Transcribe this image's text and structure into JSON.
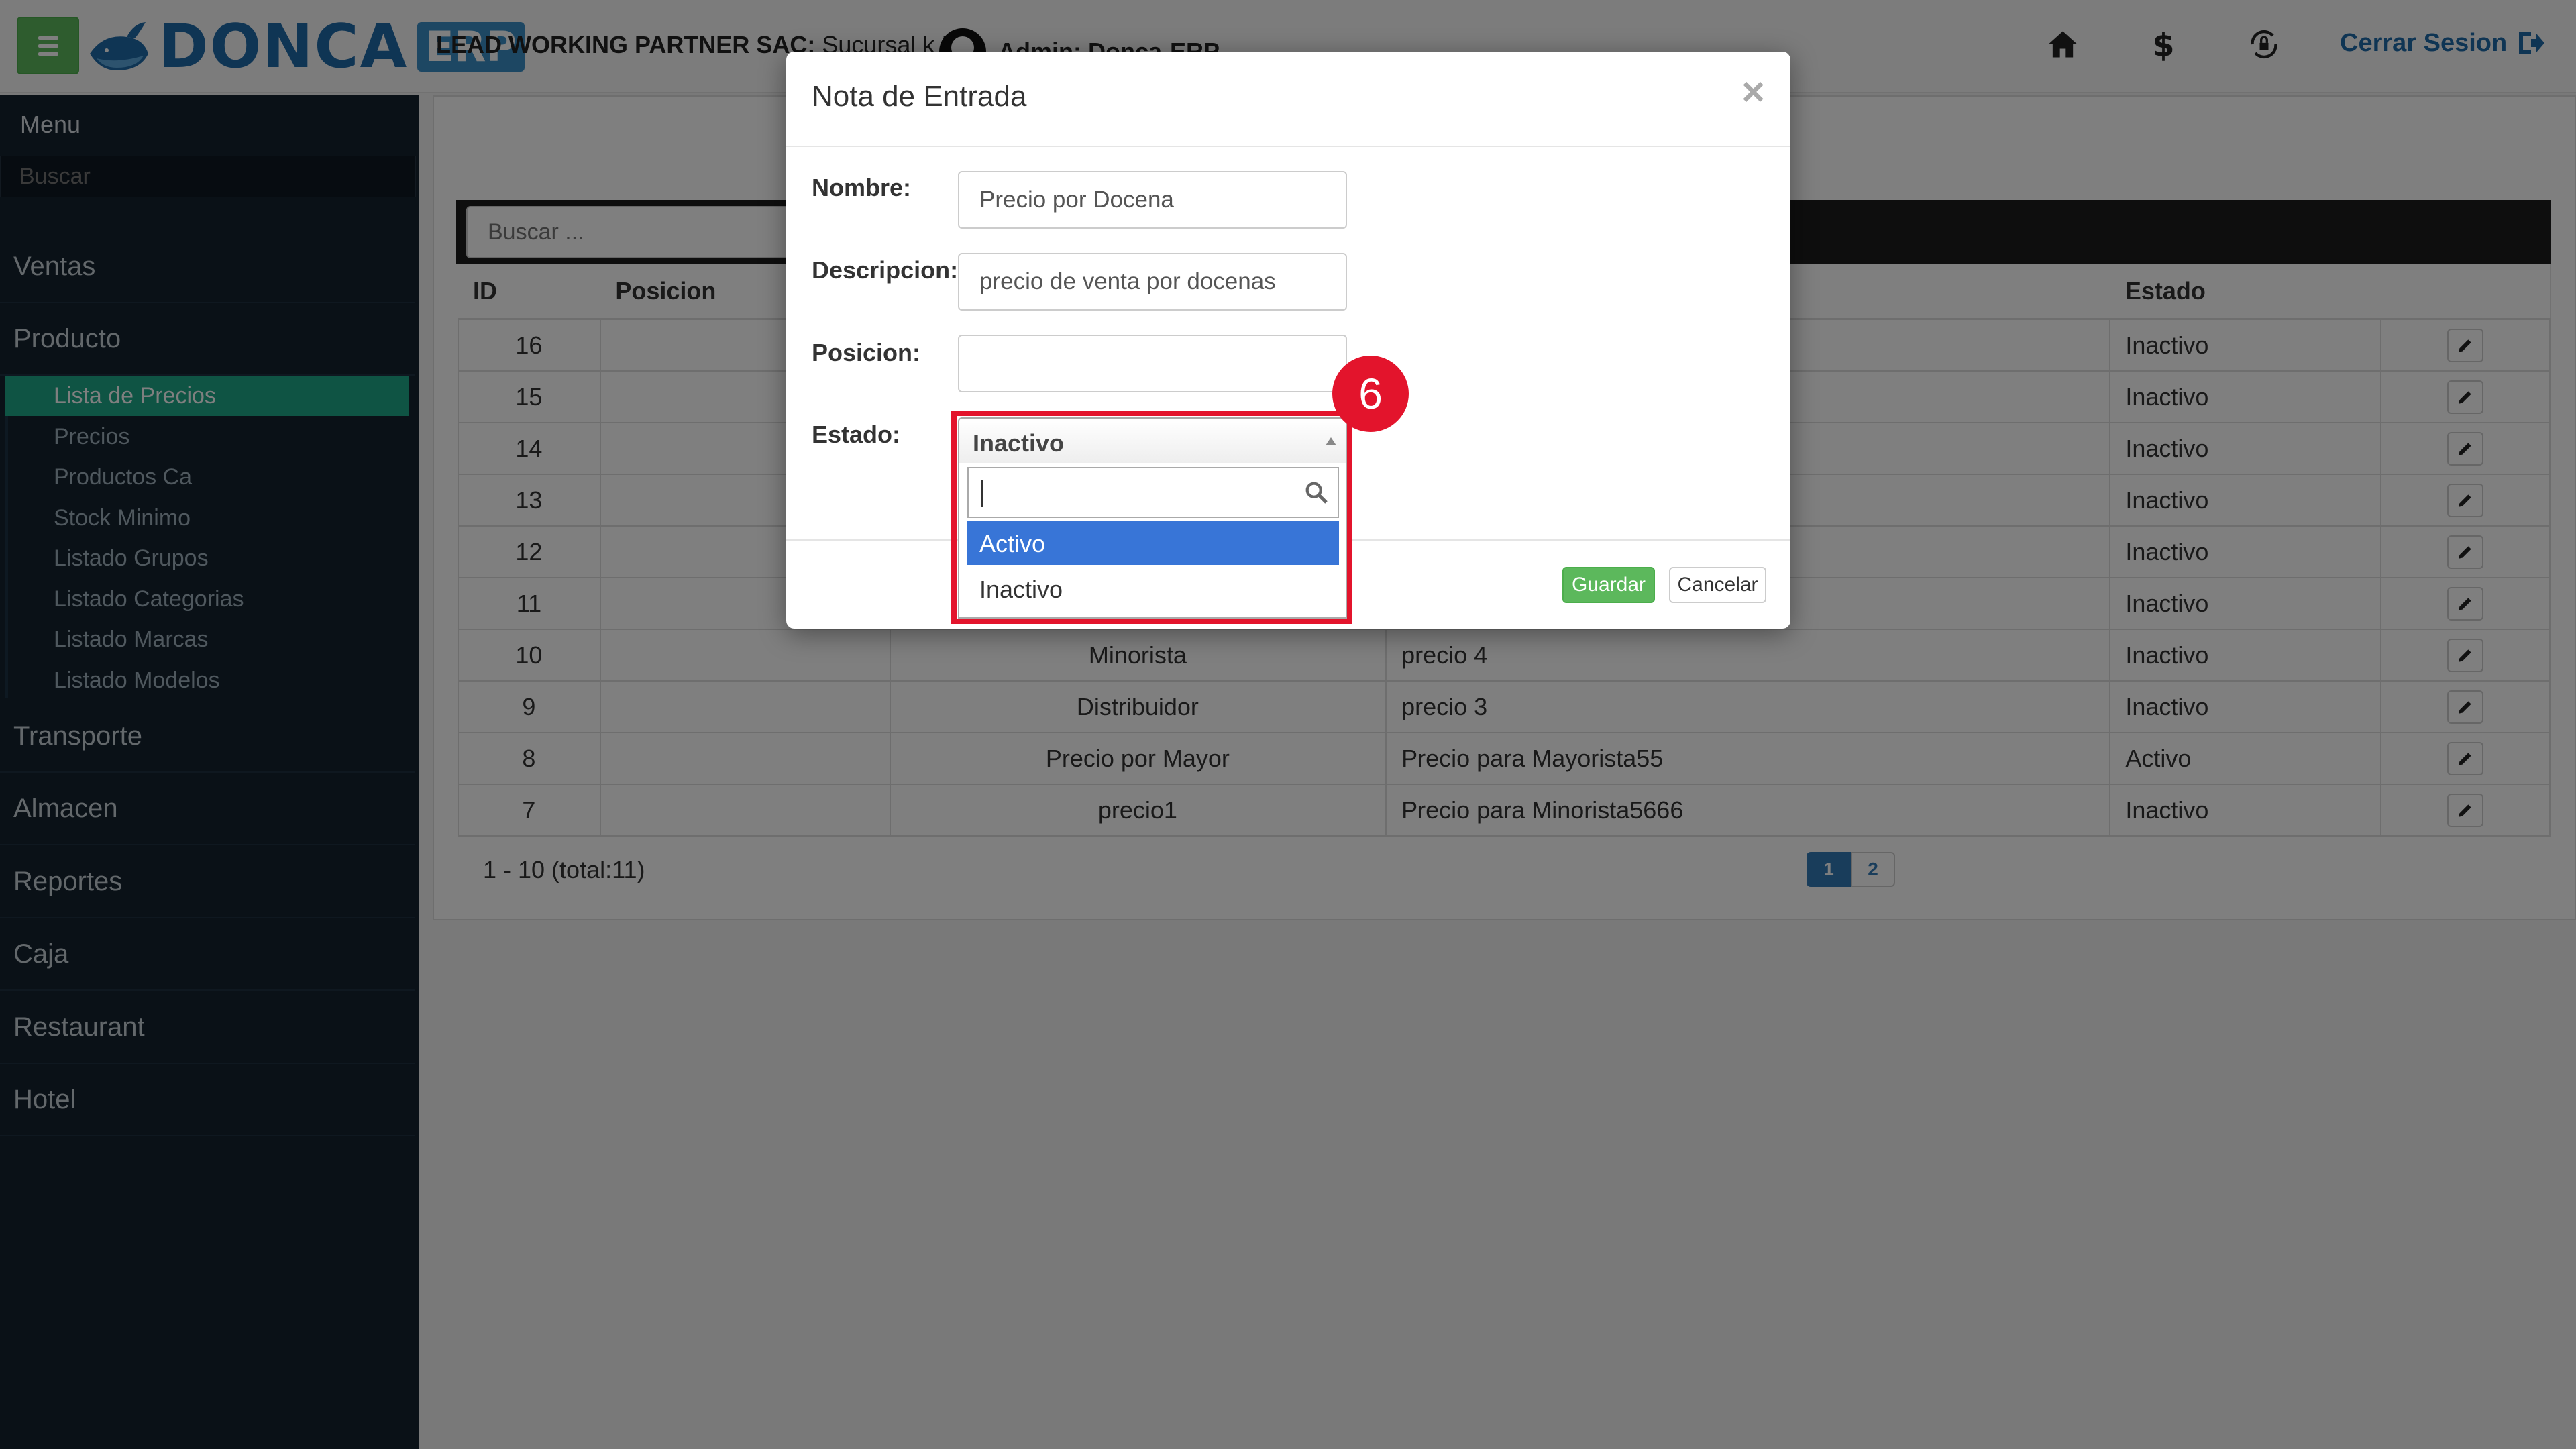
{
  "header": {
    "brand_name": "DONCA",
    "brand_suffix": "ERP",
    "company_prefix": "LEAD WORKING PARTNER SAC:",
    "company_branch": " Sucursal k |",
    "user_label": "Admin: Donca-ERP",
    "logout_label": "Cerrar Sesion",
    "icons": [
      "menu-icon",
      "home-icon",
      "dollar-icon",
      "lock-refresh-icon",
      "sign-out-icon"
    ]
  },
  "sidebar": {
    "menu_title": "Menu",
    "search_placeholder": "Buscar",
    "items": [
      "Ventas",
      "Producto",
      "Transporte",
      "Almacen",
      "Reportes",
      "Caja",
      "Restaurant",
      "Hotel"
    ],
    "sub_items": [
      "Lista de Precios",
      "Precios",
      "Productos Ca",
      "Stock Minimo",
      "Listado Grupos",
      "Listado Categorias",
      "Listado Marcas",
      "Listado Modelos"
    ],
    "active_sub": "Lista de Precios"
  },
  "table": {
    "search_placeholder": "Buscar ...",
    "columns": [
      "ID",
      "Posicion",
      "",
      "",
      "Estado",
      ""
    ],
    "rows": [
      {
        "id": "16",
        "posicion": "",
        "nombre": "",
        "descripcion": "",
        "estado": "Inactivo"
      },
      {
        "id": "15",
        "posicion": "",
        "nombre": "",
        "descripcion": "",
        "estado": "Inactivo"
      },
      {
        "id": "14",
        "posicion": "",
        "nombre": "",
        "descripcion": "",
        "estado": "Inactivo"
      },
      {
        "id": "13",
        "posicion": "",
        "nombre": "",
        "descripcion": "",
        "estado": "Inactivo"
      },
      {
        "id": "12",
        "posicion": "",
        "nombre": "",
        "descripcion": "",
        "estado": "Inactivo"
      },
      {
        "id": "11",
        "posicion": "",
        "nombre": "",
        "descripcion": "",
        "estado": "Inactivo"
      },
      {
        "id": "10",
        "posicion": "",
        "nombre": "Minorista",
        "descripcion": "precio 4",
        "estado": "Inactivo"
      },
      {
        "id": "9",
        "posicion": "",
        "nombre": "Distribuidor",
        "descripcion": "precio 3",
        "estado": "Inactivo"
      },
      {
        "id": "8",
        "posicion": "",
        "nombre": "Precio por Mayor",
        "descripcion": "Precio para Mayorista55",
        "estado": "Activo"
      },
      {
        "id": "7",
        "posicion": "",
        "nombre": "precio1",
        "descripcion": "Precio para Minorista5666",
        "estado": "Inactivo"
      }
    ],
    "pager_info": "1 - 10 (total:11)",
    "pages": [
      "1",
      "2"
    ],
    "active_page": "1"
  },
  "modal": {
    "title": "Nota de Entrada",
    "close_glyph": "×",
    "labels": {
      "nombre": "Nombre:",
      "descripcion": "Descripcion:",
      "posicion": "Posicion:",
      "estado": "Estado:"
    },
    "values": {
      "nombre": "Precio por Docena",
      "descripcion": "precio de venta por docenas",
      "posicion": "",
      "estado": "Inactivo"
    },
    "guardar_label": "Guardar",
    "cancelar_label": "Cancelar"
  },
  "dropdown": {
    "search_value": "",
    "options": [
      "Activo",
      "Inactivo"
    ],
    "highlighted": "Activo"
  },
  "annotation": {
    "step_number": "6",
    "color": "#e3142c"
  }
}
